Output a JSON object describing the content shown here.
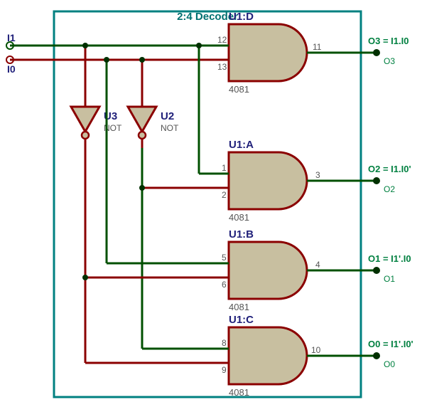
{
  "title": "2:4 Decoder",
  "inputs": {
    "i1": "I1",
    "i0": "I0"
  },
  "inverters": {
    "u3": {
      "name": "U3",
      "type": "NOT"
    },
    "u2": {
      "name": "U2",
      "type": "NOT"
    }
  },
  "gates": {
    "d": {
      "name": "U1:D",
      "type": "4081",
      "pinA": "12",
      "pinB": "13",
      "pinY": "11"
    },
    "a": {
      "name": "U1:A",
      "type": "4081",
      "pinA": "1",
      "pinB": "2",
      "pinY": "3"
    },
    "b": {
      "name": "U1:B",
      "type": "4081",
      "pinA": "5",
      "pinB": "6",
      "pinY": "4"
    },
    "c": {
      "name": "U1:C",
      "type": "4081",
      "pinA": "8",
      "pinB": "9",
      "pinY": "10"
    }
  },
  "outputs": {
    "o3": {
      "eq": "O3 = I1.I0",
      "name": "O3"
    },
    "o2": {
      "eq": "O2 = I1.I0'",
      "name": "O2"
    },
    "o1": {
      "eq": "O1 = I1'.I0",
      "name": "O1"
    },
    "o0": {
      "eq": "O0 = I1'.I0'",
      "name": "O0"
    }
  },
  "colors": {
    "bound": "#008080",
    "title": "#007070",
    "wireA": "#8B0000",
    "wireB": "#005000",
    "node": "#003000",
    "comp": "#C8BFA0",
    "inLbl": "#20207A",
    "outLbl": "#008040",
    "pinTxt": "#555"
  }
}
